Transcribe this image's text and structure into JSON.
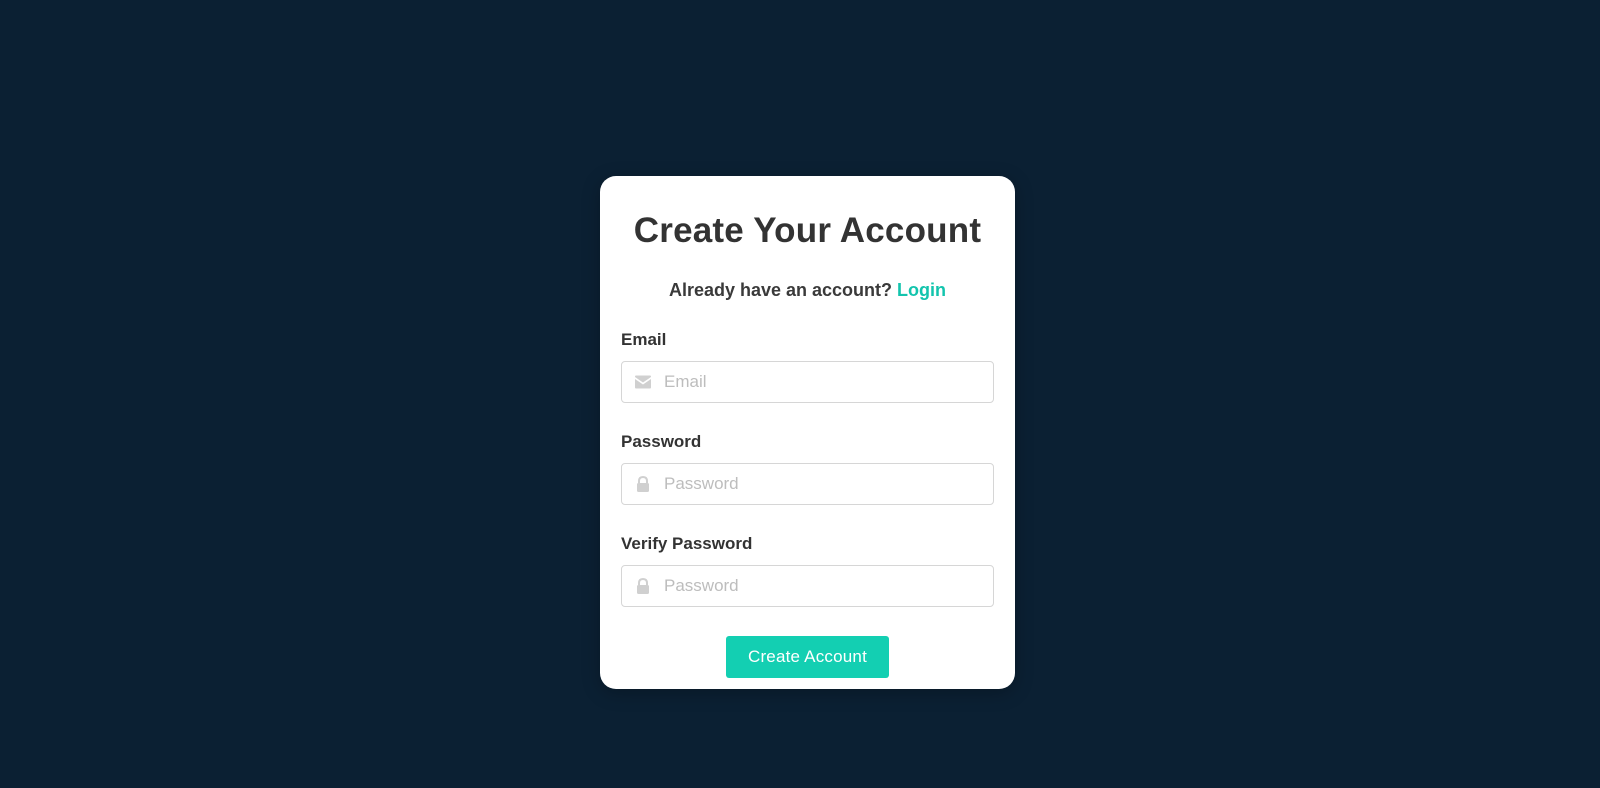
{
  "form": {
    "title": "Create Your Account",
    "subtitle_prefix": "Already have an account?",
    "login_link": "Login",
    "fields": [
      {
        "label": "Email",
        "placeholder": "Email",
        "icon": "envelope-icon"
      },
      {
        "label": "Password",
        "placeholder": "Password",
        "icon": "lock-icon"
      },
      {
        "label": "Verify Password",
        "placeholder": "Password",
        "icon": "lock-icon"
      }
    ],
    "submit_label": "Create Account"
  },
  "colors": {
    "background": "#0b2033",
    "accent": "#13cfb2",
    "link": "#13c4ad",
    "card": "#ffffff"
  }
}
